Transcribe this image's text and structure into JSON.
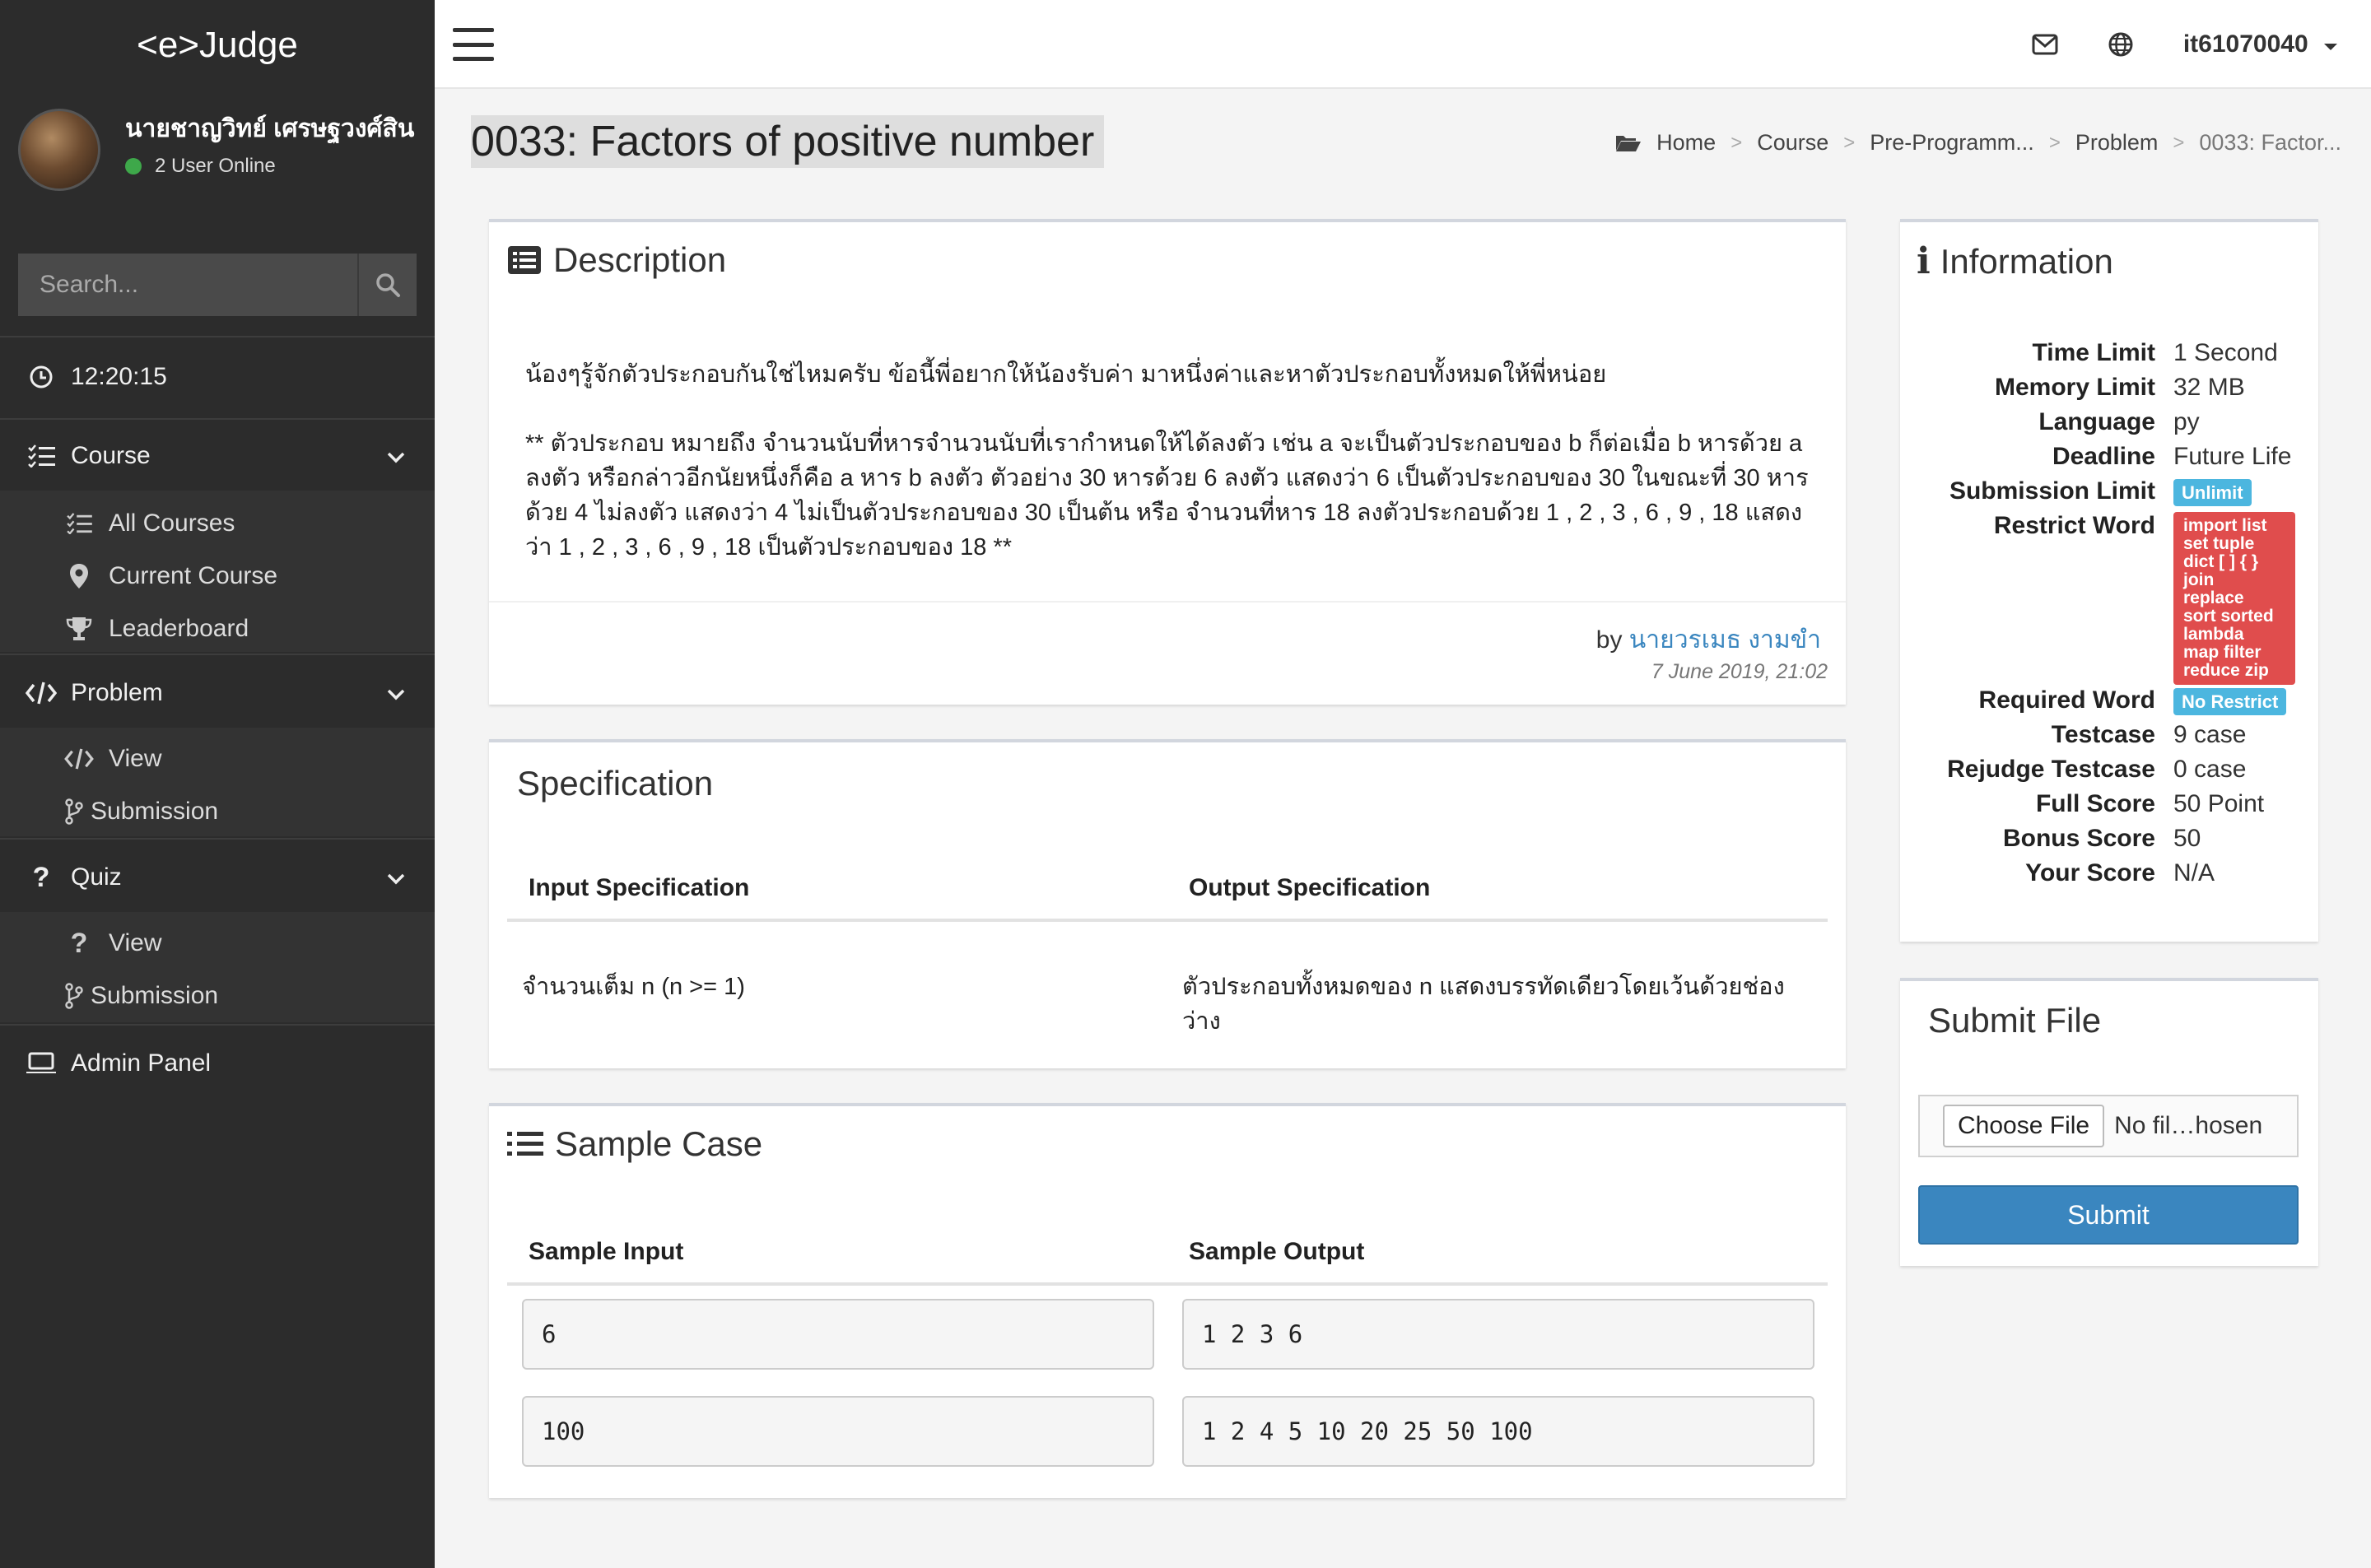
{
  "app": {
    "logo": "<e>Judge"
  },
  "user": {
    "name": "นายชาญวิทย์ เศรษฐวงศ์สิน",
    "online": "2 User Online",
    "username": "it61070040"
  },
  "search": {
    "placeholder": "Search..."
  },
  "clock": "12:20:15",
  "nav": {
    "course": {
      "label": "Course",
      "items": [
        "All Courses",
        "Current Course",
        "Leaderboard"
      ]
    },
    "problem": {
      "label": "Problem",
      "items": [
        "View",
        "Submission"
      ]
    },
    "quiz": {
      "label": "Quiz",
      "items": [
        "View",
        "Submission"
      ]
    },
    "admin": {
      "label": "Admin Panel"
    }
  },
  "page": {
    "title": "0033: Factors of positive number"
  },
  "breadcrumb": [
    "Home",
    "Course",
    "Pre-Programm...",
    "Problem",
    "0033: Factor..."
  ],
  "description": {
    "title": "Description",
    "p1": "น้องๆรู้จักตัวประกอบกันใช่ไหมครับ ข้อนี้พี่อยากให้น้องรับค่า มาหนึ่งค่าและหาตัวประกอบทั้งหมดให้พี่หน่อย",
    "p2": "** ตัวประกอบ หมายถึง จำนวนนับที่หารจำนวนนับที่เรากำหนดให้ได้ลงตัว เช่น a จะเป็นตัวประกอบของ b ก็ต่อเมื่อ b หารด้วย a ลงตัว หรือกล่าวอีกนัยหนึ่งก็คือ a หาร b ลงตัว ตัวอย่าง 30 หารด้วย 6 ลงตัว แสดงว่า 6 เป็นตัวประกอบของ 30 ในขณะที่ 30 หารด้วย 4 ไม่ลงตัว แสดงว่า 4 ไม่เป็นตัวประกอบของ 30 เป็นต้น หรือ จำนวนที่หาร 18 ลงตัวประกอบด้วย 1 , 2 , 3 , 6 , 9 , 18 แสดงว่า 1 , 2 , 3 , 6 , 9 , 18 เป็นตัวประกอบของ 18 **",
    "by": "by",
    "author": "นายวรเมธ งามขำ",
    "date": "7 June 2019, 21:02"
  },
  "specification": {
    "title": "Specification",
    "input_header": "Input Specification",
    "output_header": "Output Specification",
    "input": "จำนวนเต็ม n (n >= 1)",
    "output": "ตัวประกอบทั้งหมดของ n แสดงบรรทัดเดียวโดยเว้นด้วยช่องว่าง"
  },
  "sample": {
    "title": "Sample Case",
    "input_header": "Sample Input",
    "output_header": "Sample Output",
    "cases": [
      {
        "input": "6",
        "output": "1 2 3 6"
      },
      {
        "input": "100",
        "output": "1 2 4 5 10 20 25 50 100"
      }
    ]
  },
  "information": {
    "title": "Information",
    "rows": [
      {
        "label": "Time Limit",
        "value": "1 Second"
      },
      {
        "label": "Memory Limit",
        "value": "32 MB"
      },
      {
        "label": "Language",
        "value": "py"
      },
      {
        "label": "Deadline",
        "value": "Future Life"
      },
      {
        "label": "Submission Limit",
        "value": "Unlimit"
      },
      {
        "label": "Restrict Word",
        "value": [
          "import list",
          "set tuple",
          "dict [ ] { }",
          "join",
          "replace",
          "sort sorted",
          "lambda",
          "map filter",
          "reduce zip"
        ]
      },
      {
        "label": "Required Word",
        "value": "No Restrict"
      },
      {
        "label": "Testcase",
        "value": "9 case"
      },
      {
        "label": "Rejudge Testcase",
        "value": "0 case"
      },
      {
        "label": "Full Score",
        "value": "50 Point"
      },
      {
        "label": "Bonus Score",
        "value": "50"
      },
      {
        "label": "Your Score",
        "value": "N/A"
      }
    ]
  },
  "submit": {
    "title": "Submit File",
    "choose": "Choose File",
    "file": "No fil…hosen",
    "button": "Submit"
  },
  "colors": {
    "sidebar": "#2c2c2c",
    "accent": "#3a86bf",
    "badge_blue": "#4cb6df",
    "badge_red": "#e04d4d",
    "online": "#3ea84a"
  }
}
